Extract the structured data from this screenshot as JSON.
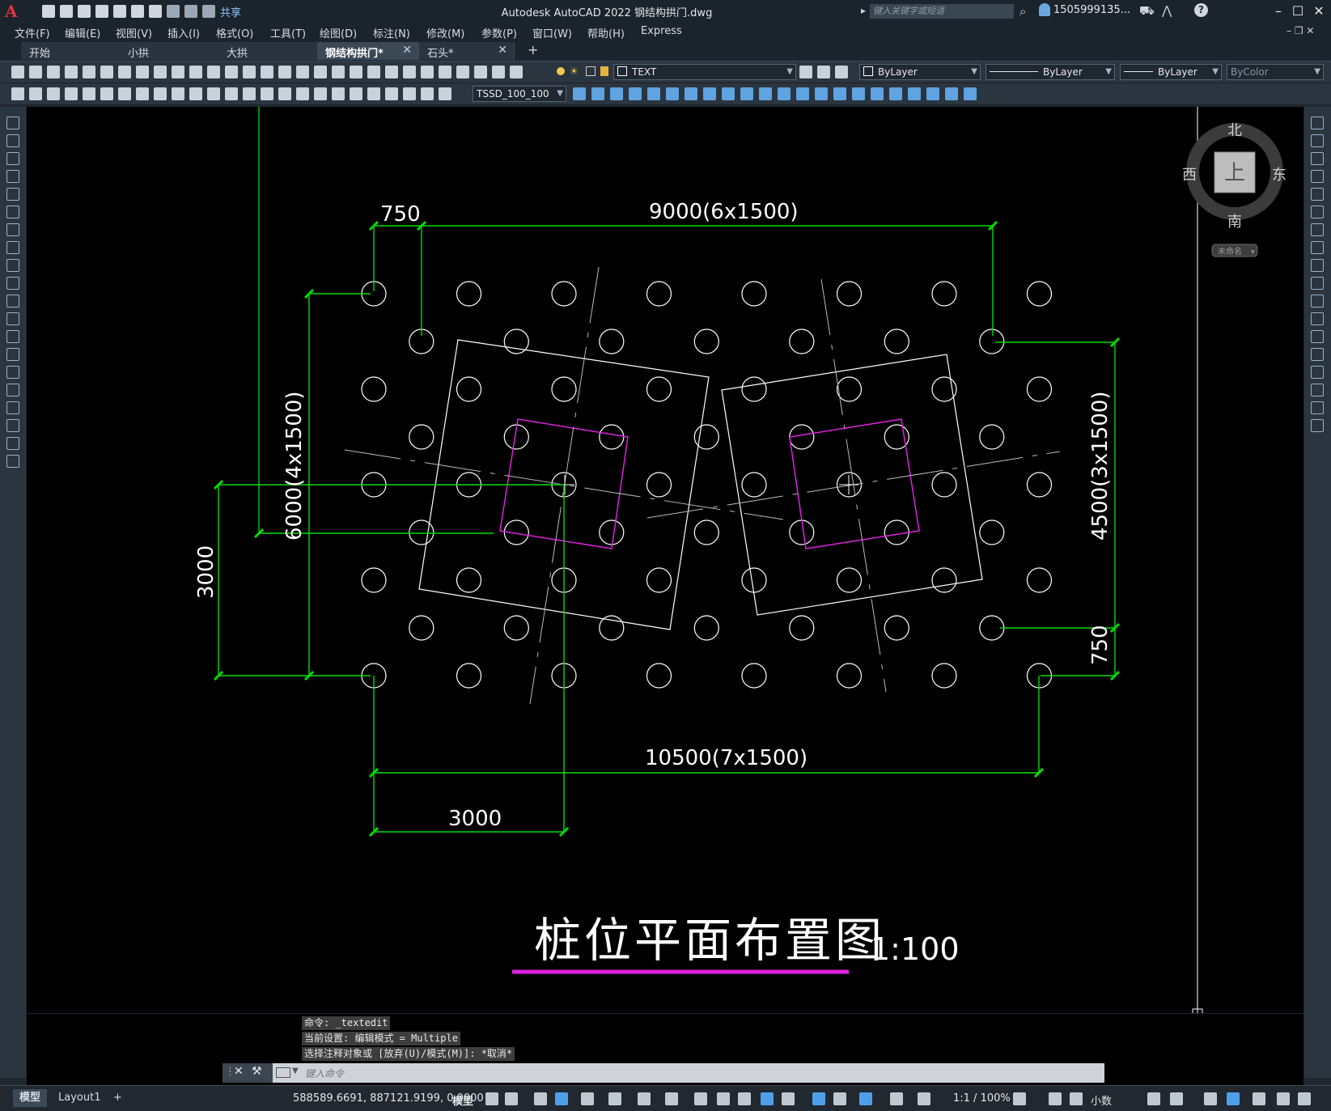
{
  "window": {
    "title": "Autodesk AutoCAD 2022    钢结构拱门.dwg",
    "search_placeholder": "键入关键字或短语",
    "user": "1505999135...",
    "share_label": "共享",
    "app_logo": "A"
  },
  "menu": [
    "文件(F)",
    "编辑(E)",
    "视图(V)",
    "插入(I)",
    "格式(O)",
    "工具(T)",
    "绘图(D)",
    "标注(N)",
    "修改(M)",
    "参数(P)",
    "窗口(W)",
    "帮助(H)",
    "Express"
  ],
  "tabs": [
    {
      "label": "开始",
      "closable": false,
      "active": false
    },
    {
      "label": "小拱",
      "closable": true,
      "active": false
    },
    {
      "label": "大拱",
      "closable": true,
      "active": false
    },
    {
      "label": "钢结构拱门*",
      "closable": true,
      "active": true
    },
    {
      "label": "石头*",
      "closable": true,
      "active": false
    }
  ],
  "properties": {
    "layer": "TEXT",
    "color": "ByLayer",
    "linetype": "ByLayer",
    "lineweight": "ByLayer",
    "plotstyle": "ByColor",
    "dimstyle": "TSSD_100_100"
  },
  "viewcube": {
    "north": "北",
    "south": "南",
    "east": "东",
    "west": "西",
    "top": "上",
    "ucs": "未命名"
  },
  "drawing": {
    "dims": {
      "top_left": "750",
      "top_main": "9000(6x1500)",
      "left_mid": "6000(4x1500)",
      "left_outer": "3000",
      "right_main": "4500(3x1500)",
      "right_small": "750",
      "bottom_main": "10500(7x1500)",
      "bottom_small": "3000"
    },
    "title": "桩位平面布置图",
    "scale": "1:100",
    "colors": {
      "dim": "#00dd00",
      "pile": "#ffffff",
      "cap": "#dd22dd",
      "bg": "#000000"
    }
  },
  "command": {
    "history": [
      "命令: _textedit",
      "当前设置: 编辑模式 = Multiple",
      "选择注释对象或 [放弃(U)/模式(M)]: *取消*"
    ],
    "placeholder": "键入命令"
  },
  "status": {
    "model_tab": "模型",
    "layout_tab": "Layout1",
    "coords": "588589.6691, 887121.9199, 0.0000",
    "model_label": "模型",
    "scale": "1:1 / 100%",
    "units": "小数"
  }
}
